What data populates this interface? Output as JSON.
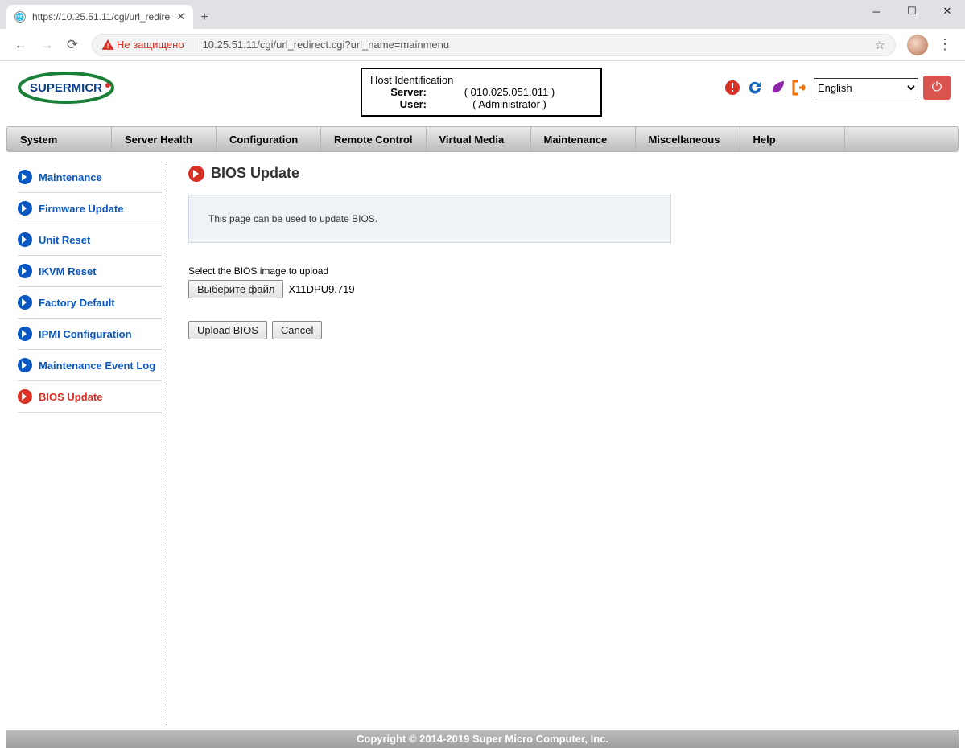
{
  "browser": {
    "tab_title": "https://10.25.51.11/cgi/url_redire",
    "not_secure_label": "Не защищено",
    "url": "10.25.51.11/cgi/url_redirect.cgi?url_name=mainmenu"
  },
  "host_identification": {
    "legend": "Host Identification",
    "server_label": "Server:",
    "server_value": "( 010.025.051.011 )",
    "user_label": "User:",
    "user_value": "( Administrator )"
  },
  "header": {
    "language": "English"
  },
  "nav": {
    "items": [
      "System",
      "Server Health",
      "Configuration",
      "Remote Control",
      "Virtual Media",
      "Maintenance",
      "Miscellaneous",
      "Help"
    ]
  },
  "sidebar": {
    "items": [
      {
        "label": "Maintenance"
      },
      {
        "label": "Firmware Update"
      },
      {
        "label": "Unit Reset"
      },
      {
        "label": "IKVM Reset"
      },
      {
        "label": "Factory Default"
      },
      {
        "label": "IPMI Configuration"
      },
      {
        "label": "Maintenance Event Log"
      },
      {
        "label": "BIOS Update",
        "active": true
      }
    ]
  },
  "main": {
    "title": "BIOS Update",
    "info": "This page can be used to update BIOS.",
    "select_label": "Select the BIOS image to upload",
    "choose_file_btn": "Выберите файл",
    "chosen_file": "X11DPU9.719",
    "upload_btn": "Upload BIOS",
    "cancel_btn": "Cancel"
  },
  "footer": {
    "text": "Copyright © 2014-2019 Super Micro Computer, Inc."
  }
}
